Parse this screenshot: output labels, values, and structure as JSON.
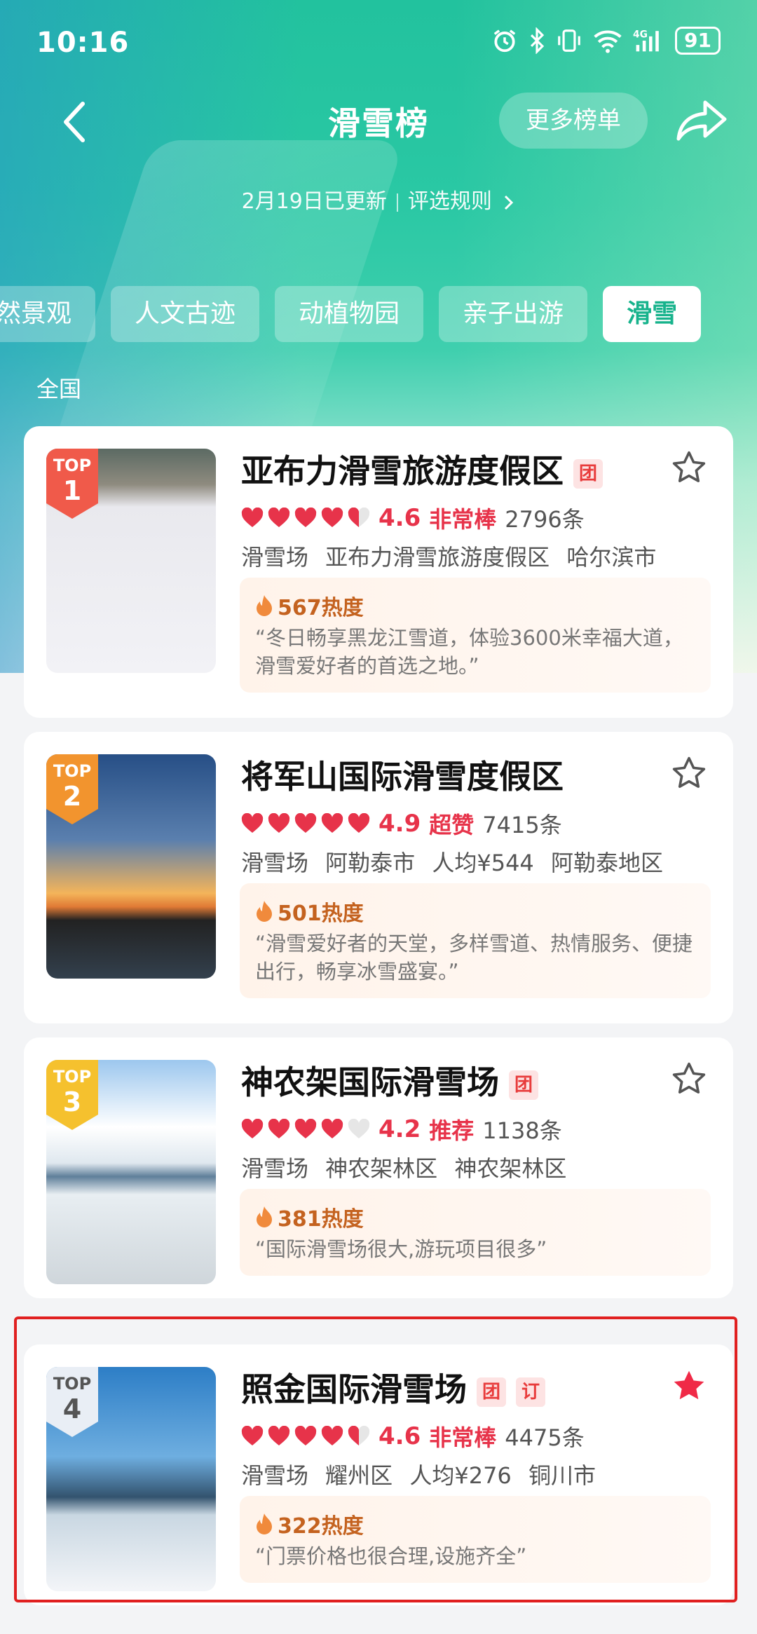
{
  "status": {
    "time": "10:16",
    "battery": "91"
  },
  "nav": {
    "title": "滑雪榜",
    "more": "更多榜单"
  },
  "updated": {
    "date": "2月19日已更新",
    "rules": "评选规则"
  },
  "tabs": [
    "然景观",
    "人文古迹",
    "动植物园",
    "亲子出游",
    "滑雪"
  ],
  "region": "全国",
  "cards": [
    {
      "rank_label": "TOP",
      "rank": "1",
      "title": "亚布力滑雪旅游度假区",
      "tags": [
        "团"
      ],
      "hearts": 4.5,
      "score": "4.6",
      "level": "非常棒",
      "count": "2796条",
      "info": "滑雪场  亚布力滑雪旅游度假区  哈尔滨市",
      "hot": "567热度",
      "quote": "“冬日畅享黑龙江雪道，体验3600米幸福大道，滑雪爱好者的首选之地。”",
      "starred": false
    },
    {
      "rank_label": "TOP",
      "rank": "2",
      "title": "将军山国际滑雪度假区",
      "tags": [],
      "hearts": 5,
      "score": "4.9",
      "level": "超赞",
      "count": "7415条",
      "info": "滑雪场  阿勒泰市  人均¥544  阿勒泰地区",
      "hot": "501热度",
      "quote": "“滑雪爱好者的天堂，多样雪道、热情服务、便捷出行，畅享冰雪盛宴。”",
      "starred": false
    },
    {
      "rank_label": "TOP",
      "rank": "3",
      "title": "神农架国际滑雪场",
      "tags": [
        "团"
      ],
      "hearts": 4,
      "score": "4.2",
      "level": "推荐",
      "count": "1138条",
      "info": "滑雪场  神农架林区  神农架林区",
      "hot": "381热度",
      "quote": "“国际滑雪场很大,游玩项目很多”",
      "starred": false
    },
    {
      "rank_label": "TOP",
      "rank": "4",
      "title": "照金国际滑雪场",
      "tags": [
        "团",
        "订"
      ],
      "hearts": 4.5,
      "score": "4.6",
      "level": "非常棒",
      "count": "4475条",
      "info": "滑雪场  耀州区  人均¥276  铜川市",
      "hot": "322热度",
      "quote": "“门票价格也很合理,设施齐全”",
      "starred": true
    }
  ],
  "colors": {
    "accent": "#17b38c",
    "heart": "#e7334a",
    "badge1": "#f05a4a",
    "badge2": "#f2942e",
    "badge3": "#f5c12e",
    "badge4": "#e9eef5",
    "star_active": "#f02a47"
  }
}
